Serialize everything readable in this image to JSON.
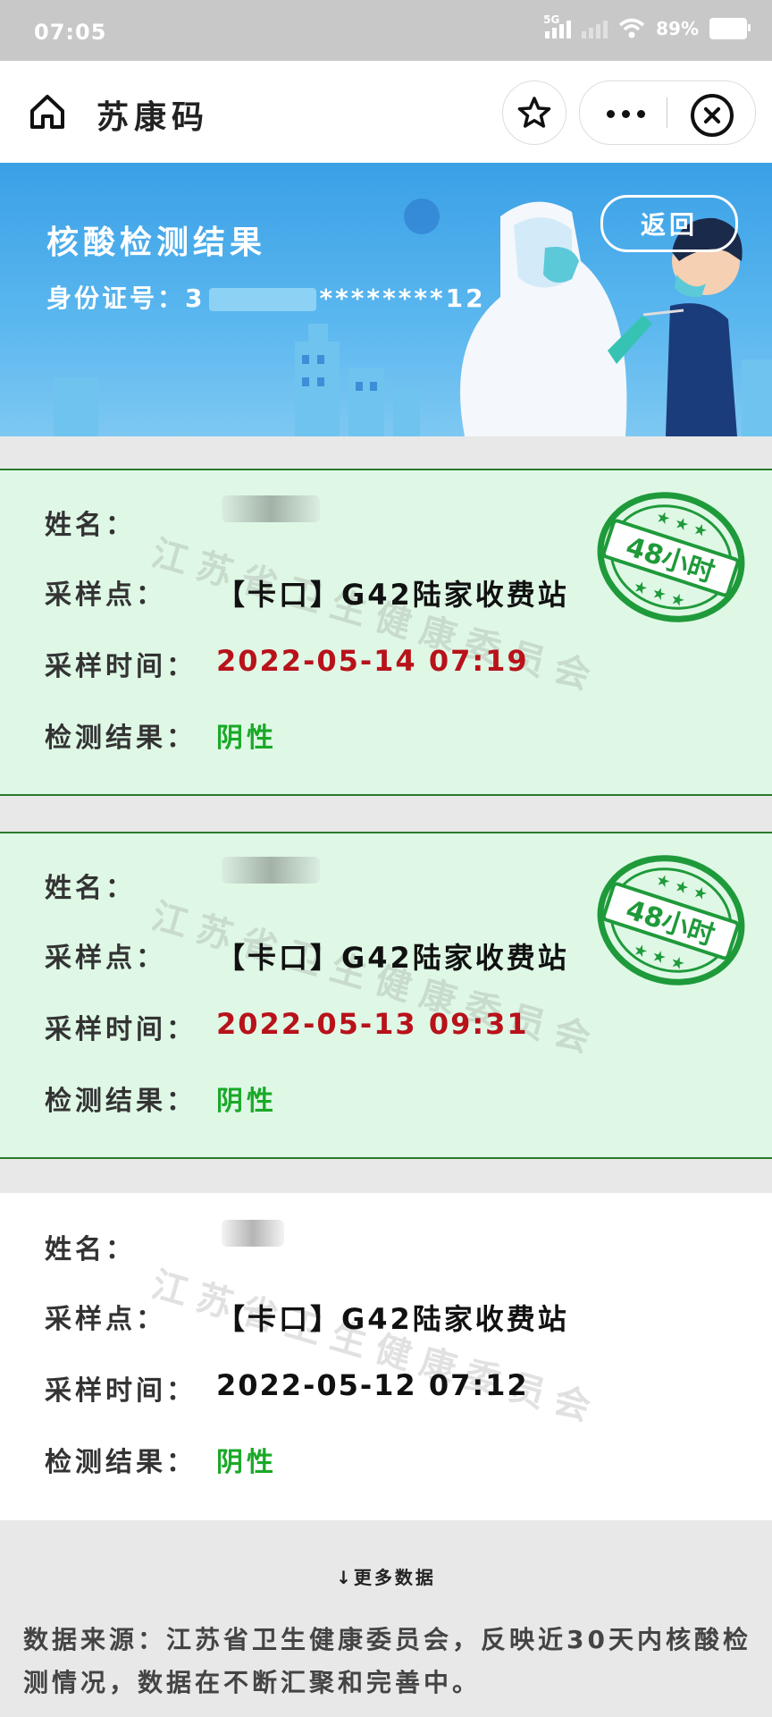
{
  "status_bar": {
    "time": "07:05",
    "network": "5G",
    "battery": "89%"
  },
  "nav": {
    "title": "苏康码"
  },
  "banner": {
    "heading": "核酸检测结果",
    "id_label": "身份证号：",
    "id_prefix": "3",
    "id_mask": "********12",
    "back_label": "返回"
  },
  "labels": {
    "name": "姓名：",
    "site": "采样点：",
    "time": "采样时间：",
    "result": "检测结果："
  },
  "records": [
    {
      "site": "【卡口】G42陆家收费站",
      "time": "2022-05-14 07:19",
      "result": "阴性",
      "badge": "48小时",
      "watermark": "江苏省卫生健康委员会"
    },
    {
      "site": "【卡口】G42陆家收费站",
      "time": "2022-05-13 09:31",
      "result": "阴性",
      "badge": "48小时",
      "watermark": "江苏省卫生健康委员会"
    },
    {
      "site": "【卡口】G42陆家收费站",
      "time": "2022-05-12 07:12",
      "result": "阴性",
      "watermark": "江苏省卫生健康委员会"
    }
  ],
  "more_label": "↓更多数据",
  "footer": "数据来源：江苏省卫生健康委员会，反映近30天内核酸检测情况，数据在不断汇聚和完善中。",
  "colors": {
    "banner": "#4aaae9",
    "card_green": "#dff8e6",
    "time_red": "#b8121a",
    "result_green": "#1aa928",
    "stamp_green": "#1f9a3a"
  }
}
